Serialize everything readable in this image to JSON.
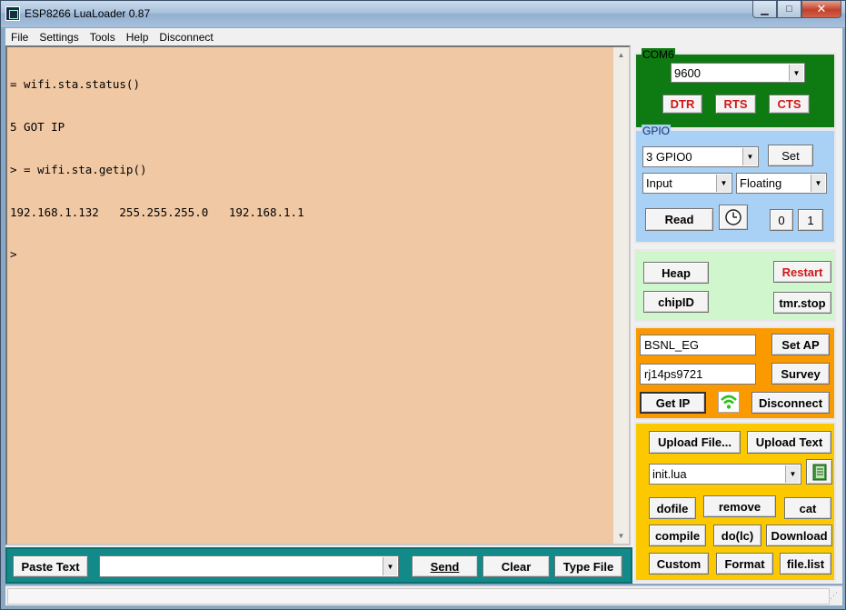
{
  "window": {
    "title": "ESP8266 LuaLoader 0.87",
    "min_label": "▁",
    "max_label": "□",
    "close_label": "✕"
  },
  "menu": [
    "File",
    "Settings",
    "Tools",
    "Help",
    "Disconnect"
  ],
  "terminal": {
    "lines": [
      "= wifi.sta.status()",
      "5 GOT IP",
      "> = wifi.sta.getip()",
      "192.168.1.132   255.255.255.0   192.168.1.1",
      ">"
    ]
  },
  "command_bar": {
    "paste_text": "Paste Text",
    "command_input": "",
    "send": "Send",
    "clear": "Clear",
    "type_file": "Type File"
  },
  "com": {
    "port_label": "COM6",
    "baud": "9600",
    "dtr": "DTR",
    "rts": "RTS",
    "cts": "CTS"
  },
  "gpio": {
    "label": "GPIO",
    "pin": "3 GPIO0",
    "set": "Set",
    "mode": "Input",
    "pull": "Floating",
    "read": "Read",
    "zero": "0",
    "one": "1"
  },
  "misc": {
    "heap": "Heap",
    "restart": "Restart",
    "chipid": "chipID",
    "tmr_stop": "tmr.stop"
  },
  "wifi": {
    "ssid": "BSNL_EG",
    "password": "rj14ps9721",
    "set_ap": "Set AP",
    "survey": "Survey",
    "get_ip": "Get IP",
    "disconnect": "Disconnect"
  },
  "files": {
    "upload_file": "Upload File...",
    "upload_text": "Upload Text",
    "selected_file": "init.lua",
    "dofile": "dofile",
    "remove": "remove",
    "cat": "cat",
    "compile": "compile",
    "do_lc": "do(lc)",
    "download": "Download",
    "custom": "Custom",
    "format": "Format",
    "file_list": "file.list"
  },
  "colors": {
    "terminal_bg": "#f0c8a4",
    "command_bar": "#138a8a",
    "com_panel": "#0e7a12",
    "gpio_panel": "#a9d0f5",
    "misc_panel": "#cff6cc",
    "wifi_panel": "#fb9900",
    "file_panel": "#fcc900",
    "wifi_icon": "#2cc21a"
  }
}
